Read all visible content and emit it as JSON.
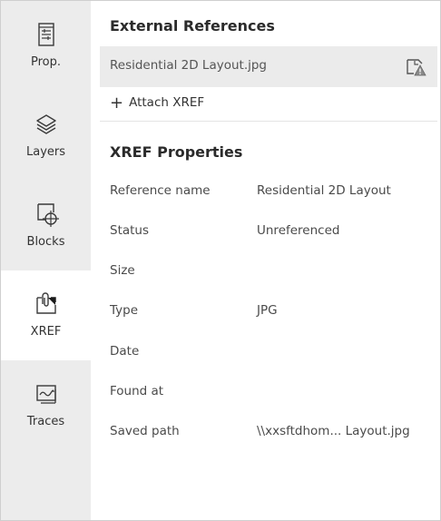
{
  "sidebar": {
    "items": [
      {
        "label": "Prop.",
        "icon": "properties-icon",
        "active": false
      },
      {
        "label": "Layers",
        "icon": "layers-icon",
        "active": false
      },
      {
        "label": "Blocks",
        "icon": "blocks-icon",
        "active": false
      },
      {
        "label": "XREF",
        "icon": "xref-icon",
        "active": true
      },
      {
        "label": "Traces",
        "icon": "traces-icon",
        "active": false
      }
    ]
  },
  "external_references": {
    "title": "External References",
    "selected_file": "Residential 2D Layout.jpg",
    "status_icon": "unreferenced-warning-icon",
    "attach_label": "Attach XREF"
  },
  "xref_properties": {
    "title": "XREF Properties",
    "rows": [
      {
        "key": "Reference name",
        "value": "Residential 2D Layout"
      },
      {
        "key": "Status",
        "value": "Unreferenced"
      },
      {
        "key": "Size",
        "value": ""
      },
      {
        "key": "Type",
        "value": "JPG"
      },
      {
        "key": "Date",
        "value": ""
      },
      {
        "key": "Found at",
        "value": ""
      },
      {
        "key": "Saved path",
        "value": "\\\\xxsftdhom... Layout.jpg"
      }
    ]
  },
  "colors": {
    "sidebar_bg": "#ececec",
    "active_bg": "#ffffff",
    "selected_row_bg": "#ebebeb",
    "text": "#2b2b2b"
  }
}
